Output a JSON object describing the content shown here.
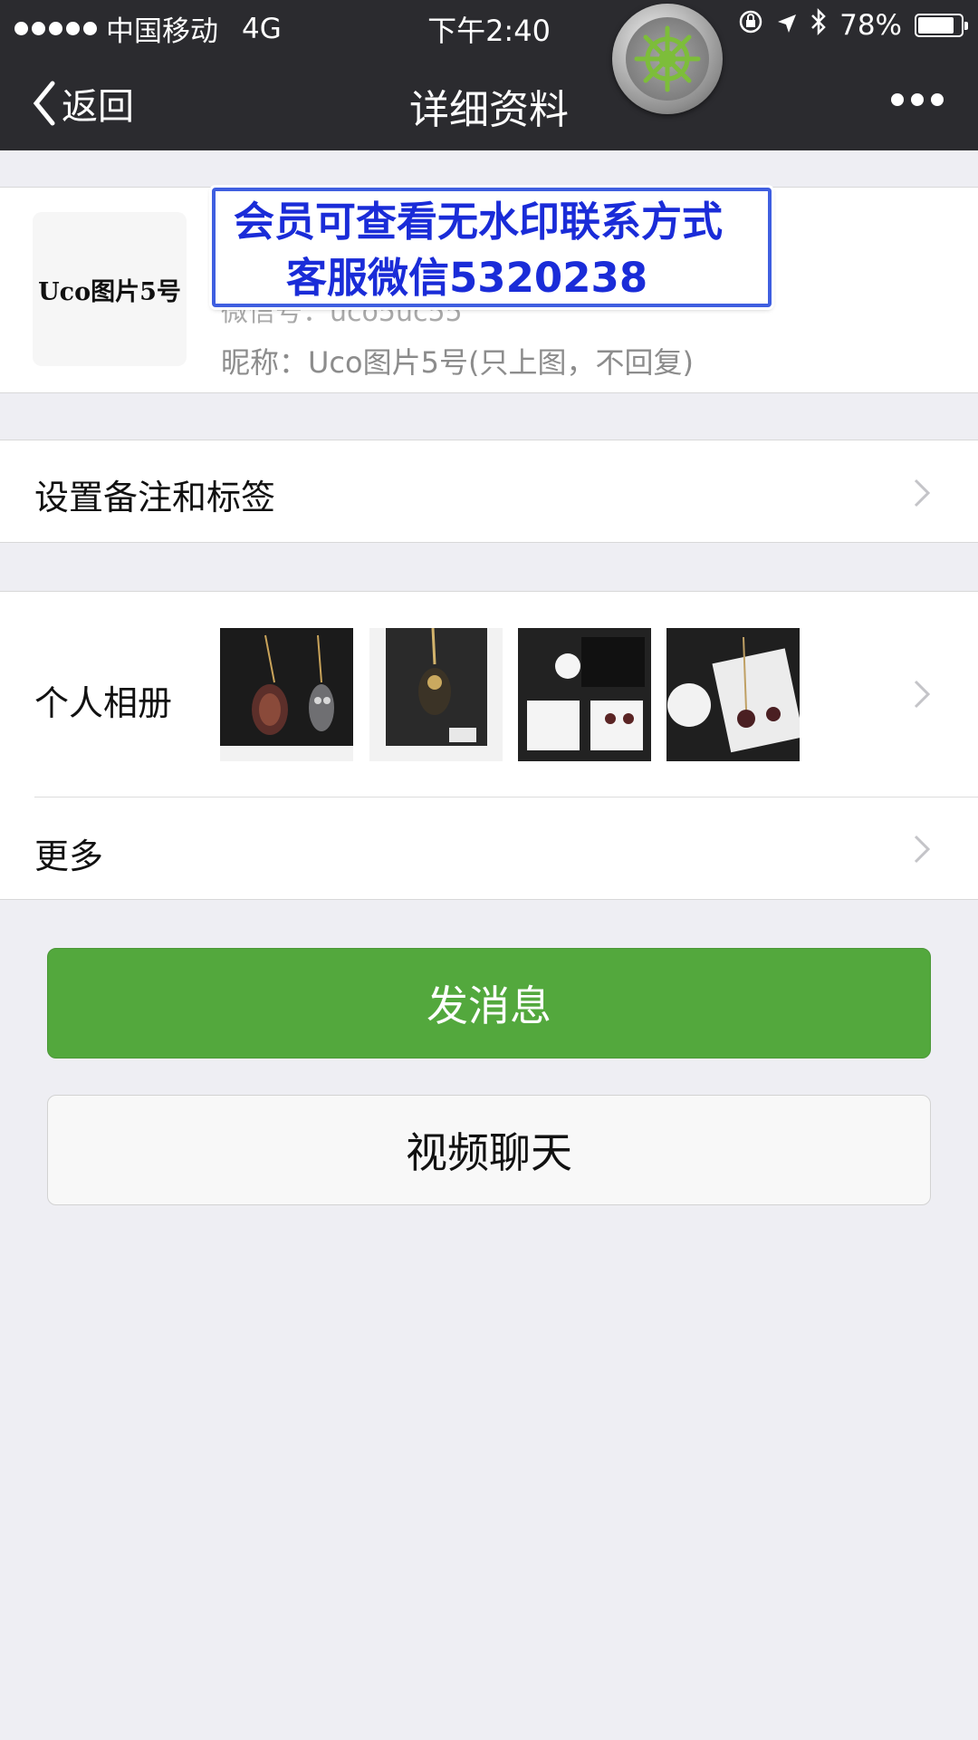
{
  "status_bar": {
    "carrier": "中国移动",
    "network": "4G",
    "time": "下午2:40",
    "battery": "78%",
    "battery_level": 0.78
  },
  "nav": {
    "back_label": "返回",
    "title": "详细资料"
  },
  "profile": {
    "avatar_text": "Uco图片5号",
    "wechat_id_partial": "微信号：uco5uc55",
    "nickname": "昵称：Uco图片5号(只上图，不回复)"
  },
  "watermark": {
    "line1": "会员可查看无水印联系方式",
    "line2": "客服微信5320238"
  },
  "rows": {
    "remark_label": "设置备注和标签",
    "album_label": "个人相册",
    "more_label": "更多"
  },
  "buttons": {
    "send_message": "发消息",
    "video_chat": "视频聊天"
  },
  "colors": {
    "nav_bg": "#2b2b2f",
    "page_bg": "#eeeef3",
    "primary_green": "#53a83d",
    "watermark_blue": "#1a2cd8"
  }
}
